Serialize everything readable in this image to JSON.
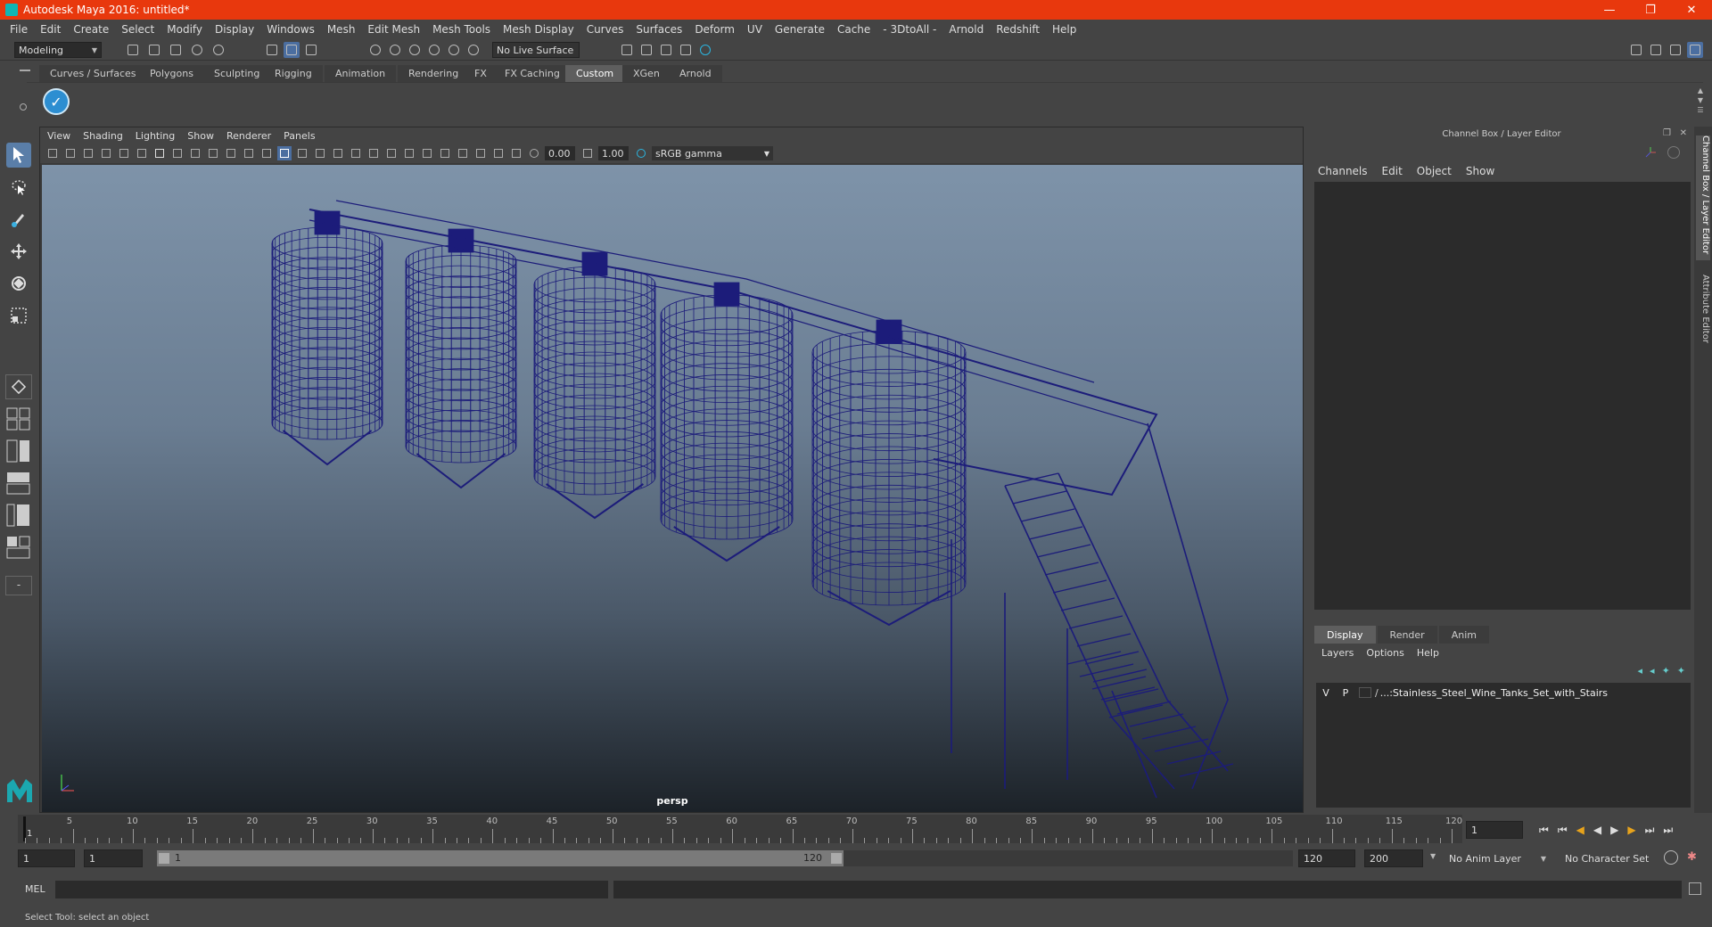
{
  "window": {
    "title": "Autodesk Maya 2016: untitled*"
  },
  "menu": [
    "File",
    "Edit",
    "Create",
    "Select",
    "Modify",
    "Display",
    "Windows",
    "Mesh",
    "Edit Mesh",
    "Mesh Tools",
    "Mesh Display",
    "Curves",
    "Surfaces",
    "Deform",
    "UV",
    "Generate",
    "Cache",
    "- 3DtoAll -",
    "Arnold",
    "Redshift",
    "Help"
  ],
  "status": {
    "mode": "Modeling",
    "live_surface": "No Live Surface"
  },
  "shelf_tabs": [
    "Curves / Surfaces",
    "Polygons",
    "Sculpting",
    "Rigging",
    "Animation",
    "Rendering",
    "FX",
    "FX Caching",
    "Custom",
    "XGen",
    "Arnold"
  ],
  "active_shelf_tab": "Custom",
  "panel_menu": [
    "View",
    "Shading",
    "Lighting",
    "Show",
    "Renderer",
    "Panels"
  ],
  "panel_toolbar": {
    "exposure": "0.00",
    "gamma": "1.00",
    "color_space": "sRGB gamma"
  },
  "viewport": {
    "camera": "persp",
    "wire_color": "#1c1c7a"
  },
  "channel_box": {
    "title": "Channel Box / Layer Editor",
    "menu": [
      "Channels",
      "Edit",
      "Object",
      "Show"
    ]
  },
  "layer_editor": {
    "tabs": [
      "Display",
      "Render",
      "Anim"
    ],
    "active_tab": "Display",
    "menu": [
      "Layers",
      "Options",
      "Help"
    ],
    "layers": [
      {
        "v": "V",
        "p": "P",
        "name": "...:Stainless_Steel_Wine_Tanks_Set_with_Stairs"
      }
    ]
  },
  "side_tabs": [
    "Channel Box / Layer Editor",
    "Attribute Editor"
  ],
  "time_slider": {
    "ticks": [
      "5",
      "10",
      "15",
      "20",
      "25",
      "30",
      "35",
      "40",
      "45",
      "50",
      "55",
      "60",
      "65",
      "70",
      "75",
      "80",
      "85",
      "90",
      "95",
      "100",
      "105",
      "110",
      "115",
      "120"
    ],
    "start_label": "1",
    "current_frame": "1"
  },
  "range": {
    "start": "1",
    "playback_start": "1",
    "range_start": "1",
    "range_end": "120",
    "playback_end": "120",
    "end": "200",
    "anim_layer": "No Anim Layer",
    "character_set": "No Character Set"
  },
  "cmd": {
    "label": "MEL"
  },
  "help_line": "Select Tool: select an object"
}
